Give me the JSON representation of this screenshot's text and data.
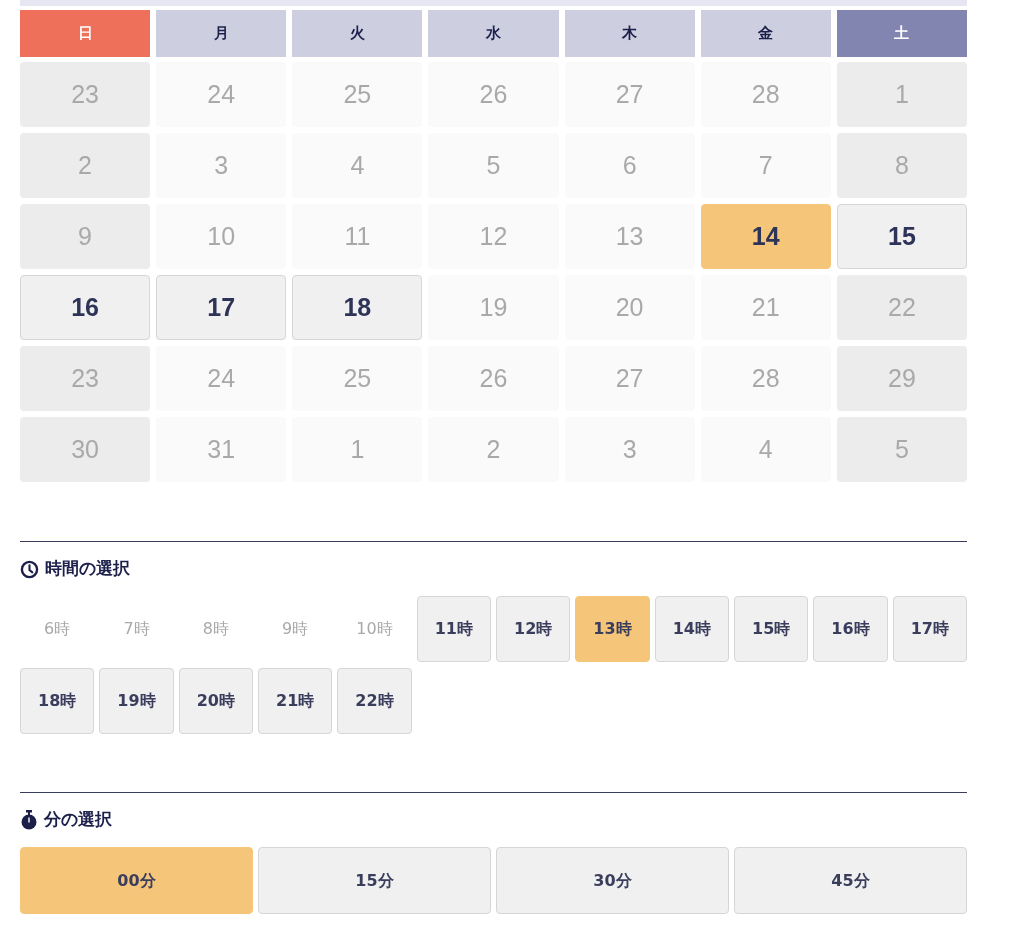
{
  "weekdays": [
    {
      "label": "日",
      "kind": "sunday"
    },
    {
      "label": "月",
      "kind": "weekday"
    },
    {
      "label": "火",
      "kind": "weekday"
    },
    {
      "label": "水",
      "kind": "weekday"
    },
    {
      "label": "木",
      "kind": "weekday"
    },
    {
      "label": "金",
      "kind": "weekday"
    },
    {
      "label": "土",
      "kind": "saturday"
    }
  ],
  "days": [
    {
      "label": "23",
      "disabled": true,
      "selected": false
    },
    {
      "label": "24",
      "disabled": true,
      "selected": false
    },
    {
      "label": "25",
      "disabled": true,
      "selected": false
    },
    {
      "label": "26",
      "disabled": true,
      "selected": false
    },
    {
      "label": "27",
      "disabled": true,
      "selected": false
    },
    {
      "label": "28",
      "disabled": true,
      "selected": false
    },
    {
      "label": "1",
      "disabled": true,
      "selected": false
    },
    {
      "label": "2",
      "disabled": true,
      "selected": false
    },
    {
      "label": "3",
      "disabled": true,
      "selected": false
    },
    {
      "label": "4",
      "disabled": true,
      "selected": false
    },
    {
      "label": "5",
      "disabled": true,
      "selected": false
    },
    {
      "label": "6",
      "disabled": true,
      "selected": false
    },
    {
      "label": "7",
      "disabled": true,
      "selected": false
    },
    {
      "label": "8",
      "disabled": true,
      "selected": false
    },
    {
      "label": "9",
      "disabled": true,
      "selected": false
    },
    {
      "label": "10",
      "disabled": true,
      "selected": false
    },
    {
      "label": "11",
      "disabled": true,
      "selected": false
    },
    {
      "label": "12",
      "disabled": true,
      "selected": false
    },
    {
      "label": "13",
      "disabled": true,
      "selected": false
    },
    {
      "label": "14",
      "disabled": false,
      "selected": true
    },
    {
      "label": "15",
      "disabled": false,
      "selected": false
    },
    {
      "label": "16",
      "disabled": false,
      "selected": false
    },
    {
      "label": "17",
      "disabled": false,
      "selected": false
    },
    {
      "label": "18",
      "disabled": false,
      "selected": false
    },
    {
      "label": "19",
      "disabled": true,
      "selected": false
    },
    {
      "label": "20",
      "disabled": true,
      "selected": false
    },
    {
      "label": "21",
      "disabled": true,
      "selected": false
    },
    {
      "label": "22",
      "disabled": true,
      "selected": false
    },
    {
      "label": "23",
      "disabled": true,
      "selected": false
    },
    {
      "label": "24",
      "disabled": true,
      "selected": false
    },
    {
      "label": "25",
      "disabled": true,
      "selected": false
    },
    {
      "label": "26",
      "disabled": true,
      "selected": false
    },
    {
      "label": "27",
      "disabled": true,
      "selected": false
    },
    {
      "label": "28",
      "disabled": true,
      "selected": false
    },
    {
      "label": "29",
      "disabled": true,
      "selected": false
    },
    {
      "label": "30",
      "disabled": true,
      "selected": false
    },
    {
      "label": "31",
      "disabled": true,
      "selected": false
    },
    {
      "label": "1",
      "disabled": true,
      "selected": false
    },
    {
      "label": "2",
      "disabled": true,
      "selected": false
    },
    {
      "label": "3",
      "disabled": true,
      "selected": false
    },
    {
      "label": "4",
      "disabled": true,
      "selected": false
    },
    {
      "label": "5",
      "disabled": true,
      "selected": false
    }
  ],
  "hour_section": {
    "title": "時間の選択",
    "hours": [
      {
        "label": "6時",
        "disabled": true,
        "selected": false
      },
      {
        "label": "7時",
        "disabled": true,
        "selected": false
      },
      {
        "label": "8時",
        "disabled": true,
        "selected": false
      },
      {
        "label": "9時",
        "disabled": true,
        "selected": false
      },
      {
        "label": "10時",
        "disabled": true,
        "selected": false
      },
      {
        "label": "11時",
        "disabled": false,
        "selected": false
      },
      {
        "label": "12時",
        "disabled": false,
        "selected": false
      },
      {
        "label": "13時",
        "disabled": false,
        "selected": true
      },
      {
        "label": "14時",
        "disabled": false,
        "selected": false
      },
      {
        "label": "15時",
        "disabled": false,
        "selected": false
      },
      {
        "label": "16時",
        "disabled": false,
        "selected": false
      },
      {
        "label": "17時",
        "disabled": false,
        "selected": false
      },
      {
        "label": "18時",
        "disabled": false,
        "selected": false
      },
      {
        "label": "19時",
        "disabled": false,
        "selected": false
      },
      {
        "label": "20時",
        "disabled": false,
        "selected": false
      },
      {
        "label": "21時",
        "disabled": false,
        "selected": false
      },
      {
        "label": "22時",
        "disabled": false,
        "selected": false
      }
    ]
  },
  "minute_section": {
    "title": "分の選択",
    "minutes": [
      {
        "label": "00分",
        "selected": true
      },
      {
        "label": "15分",
        "selected": false
      },
      {
        "label": "30分",
        "selected": false
      },
      {
        "label": "45分",
        "selected": false
      }
    ]
  }
}
